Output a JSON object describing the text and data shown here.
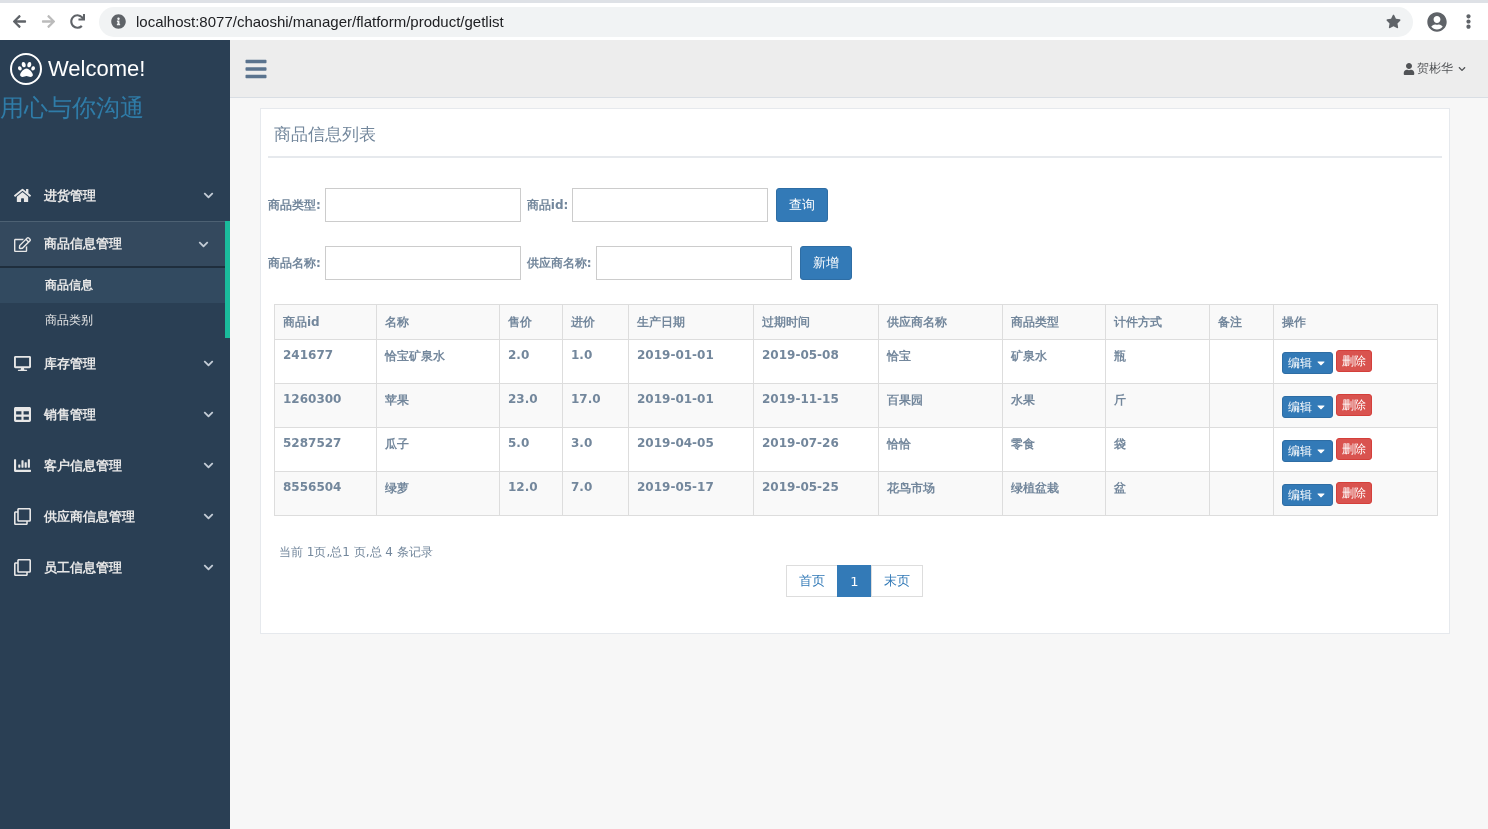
{
  "browser": {
    "url": "localhost:8077/chaoshi/manager/flatform/product/getlist"
  },
  "sidebar": {
    "title": "Welcome!",
    "slogan": "用心与你沟通",
    "items": [
      {
        "label": "进货管理",
        "expanded": false
      },
      {
        "label": "商品信息管理",
        "expanded": true,
        "children": [
          {
            "label": "商品信息",
            "selected": true
          },
          {
            "label": "商品类别",
            "selected": false
          }
        ]
      },
      {
        "label": "库存管理",
        "expanded": false
      },
      {
        "label": "销售管理",
        "expanded": false
      },
      {
        "label": "客户信息管理",
        "expanded": false
      },
      {
        "label": "供应商信息管理",
        "expanded": false
      },
      {
        "label": "员工信息管理",
        "expanded": false
      }
    ]
  },
  "topbar": {
    "user": "贺彬华"
  },
  "panel": {
    "title": "商品信息列表",
    "filters": [
      [
        {
          "label": "商品类型:"
        },
        {
          "label": "商品id:"
        }
      ],
      [
        {
          "label": "商品名称:"
        },
        {
          "label": "供应商名称:"
        }
      ]
    ],
    "filter_buttons": [
      "查询",
      "新增"
    ],
    "table": {
      "columns": [
        "商品id",
        "名称",
        "售价",
        "进价",
        "生产日期",
        "过期时间",
        "供应商名称",
        "商品类型",
        "计件方式",
        "备注",
        "操作"
      ],
      "rows": [
        {
          "cells": [
            "241677",
            "恰宝矿泉水",
            "2.0",
            "1.0",
            "2019-01-01",
            "2019-05-08",
            "恰宝",
            "矿泉水",
            "瓶",
            ""
          ],
          "edit": "编辑",
          "delete": "删除"
        },
        {
          "cells": [
            "1260300",
            "苹果",
            "23.0",
            "17.0",
            "2019-01-01",
            "2019-11-15",
            "百果园",
            "水果",
            "斤",
            ""
          ],
          "edit": "编辑",
          "delete": "删除"
        },
        {
          "cells": [
            "5287527",
            "瓜子",
            "5.0",
            "3.0",
            "2019-04-05",
            "2019-07-26",
            "恰恰",
            "零食",
            "袋",
            ""
          ],
          "edit": "编辑",
          "delete": "删除"
        },
        {
          "cells": [
            "8556504",
            "绿萝",
            "12.0",
            "7.0",
            "2019-05-17",
            "2019-05-25",
            "花鸟市场",
            "绿植盆栽",
            "盆",
            ""
          ],
          "edit": "编辑",
          "delete": "删除"
        }
      ]
    },
    "summary": "当前 1页,总1 页,总 4 条记录",
    "pagination": [
      {
        "label": "首页",
        "selected": false
      },
      {
        "label": "1",
        "selected": true
      },
      {
        "label": "末页",
        "selected": false
      }
    ]
  }
}
